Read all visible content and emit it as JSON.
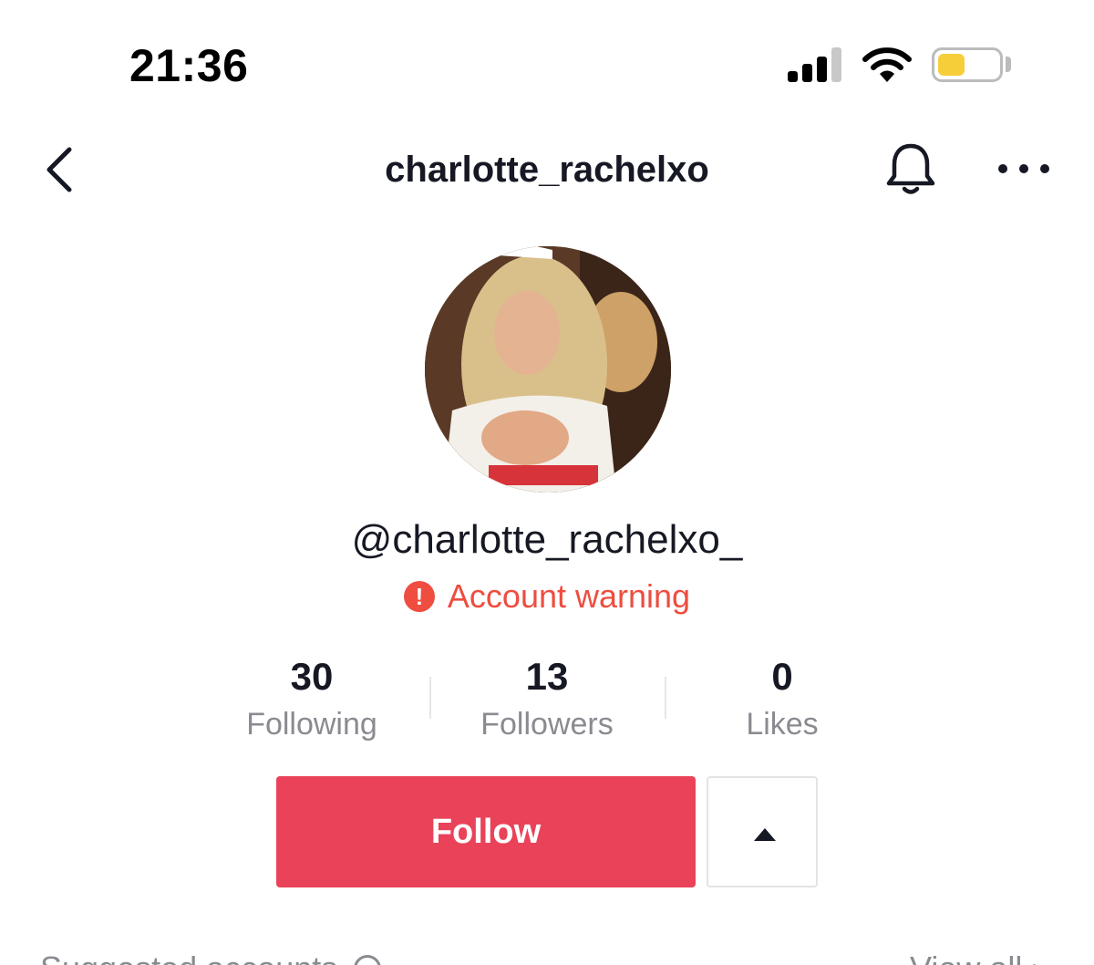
{
  "status_bar": {
    "time": "21:36",
    "signal_icon": "cellular-signal-icon",
    "wifi_icon": "wifi-icon",
    "battery_icon": "battery-icon",
    "battery_level": 0.45,
    "battery_color": "#f6ce3a"
  },
  "nav": {
    "back_icon": "chevron-left-icon",
    "title": "charlotte_rachelxo",
    "bell_icon": "bell-icon",
    "more_icon": "more-horizontal-icon"
  },
  "profile": {
    "avatar": "profile-photo",
    "handle": "@charlotte_rachelxo_",
    "warning_icon": "exclamation-circle-icon",
    "warning_symbol": "!",
    "warning_text": "Account warning",
    "warning_color": "#ee4d3f"
  },
  "stats": [
    {
      "value": "30",
      "label": "Following"
    },
    {
      "value": "13",
      "label": "Followers"
    },
    {
      "value": "0",
      "label": "Likes"
    }
  ],
  "actions": {
    "follow_label": "Follow",
    "follow_color": "#ea4359",
    "suggest_icon": "caret-up-icon"
  },
  "suggested": {
    "label": "Suggested accounts",
    "info_icon": "info-icon",
    "view_all_label": "View all",
    "view_all_icon": "chevron-right-icon"
  }
}
